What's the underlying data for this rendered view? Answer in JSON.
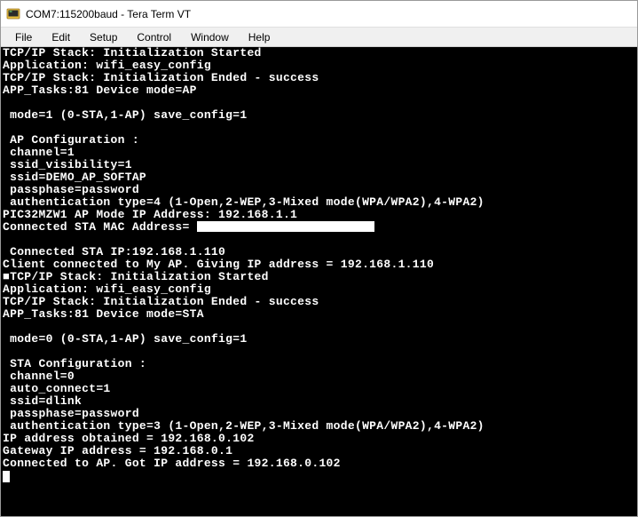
{
  "window": {
    "title": "COM7:115200baud - Tera Term VT",
    "icon_name": "teraterm-icon"
  },
  "menu": {
    "items": [
      "File",
      "Edit",
      "Setup",
      "Control",
      "Window",
      "Help"
    ]
  },
  "terminal": {
    "lines": [
      "TCP/IP Stack: Initialization Started",
      "Application: wifi_easy_config",
      "TCP/IP Stack: Initialization Ended - success",
      "APP_Tasks:81 Device mode=AP",
      "",
      " mode=1 (0-STA,1-AP) save_config=1",
      "",
      " AP Configuration :",
      " channel=1",
      " ssid_visibility=1",
      " ssid=DEMO_AP_SOFTAP",
      " passphase=password",
      " authentication type=4 (1-Open,2-WEP,3-Mixed mode(WPA/WPA2),4-WPA2)",
      "PIC32MZW1 AP Mode IP Address: 192.168.1.1",
      "Connected STA MAC Address= ",
      "",
      " Connected STA IP:192.168.1.110",
      "Client connected to My AP. Giving IP address = 192.168.1.110",
      "■TCP/IP Stack: Initialization Started",
      "Application: wifi_easy_config",
      "TCP/IP Stack: Initialization Ended - success",
      "APP_Tasks:81 Device mode=STA",
      "",
      " mode=0 (0-STA,1-AP) save_config=1",
      "",
      " STA Configuration :",
      " channel=0",
      " auto_connect=1",
      " ssid=dlink",
      " passphase=password",
      " authentication type=3 (1-Open,2-WEP,3-Mixed mode(WPA/WPA2),4-WPA2)",
      "IP address obtained = 192.168.0.102",
      "Gateway IP address = 192.168.0.1",
      "Connected to AP. Got IP address = 192.168.0.102"
    ],
    "mac_redacted_line_index": 14
  }
}
